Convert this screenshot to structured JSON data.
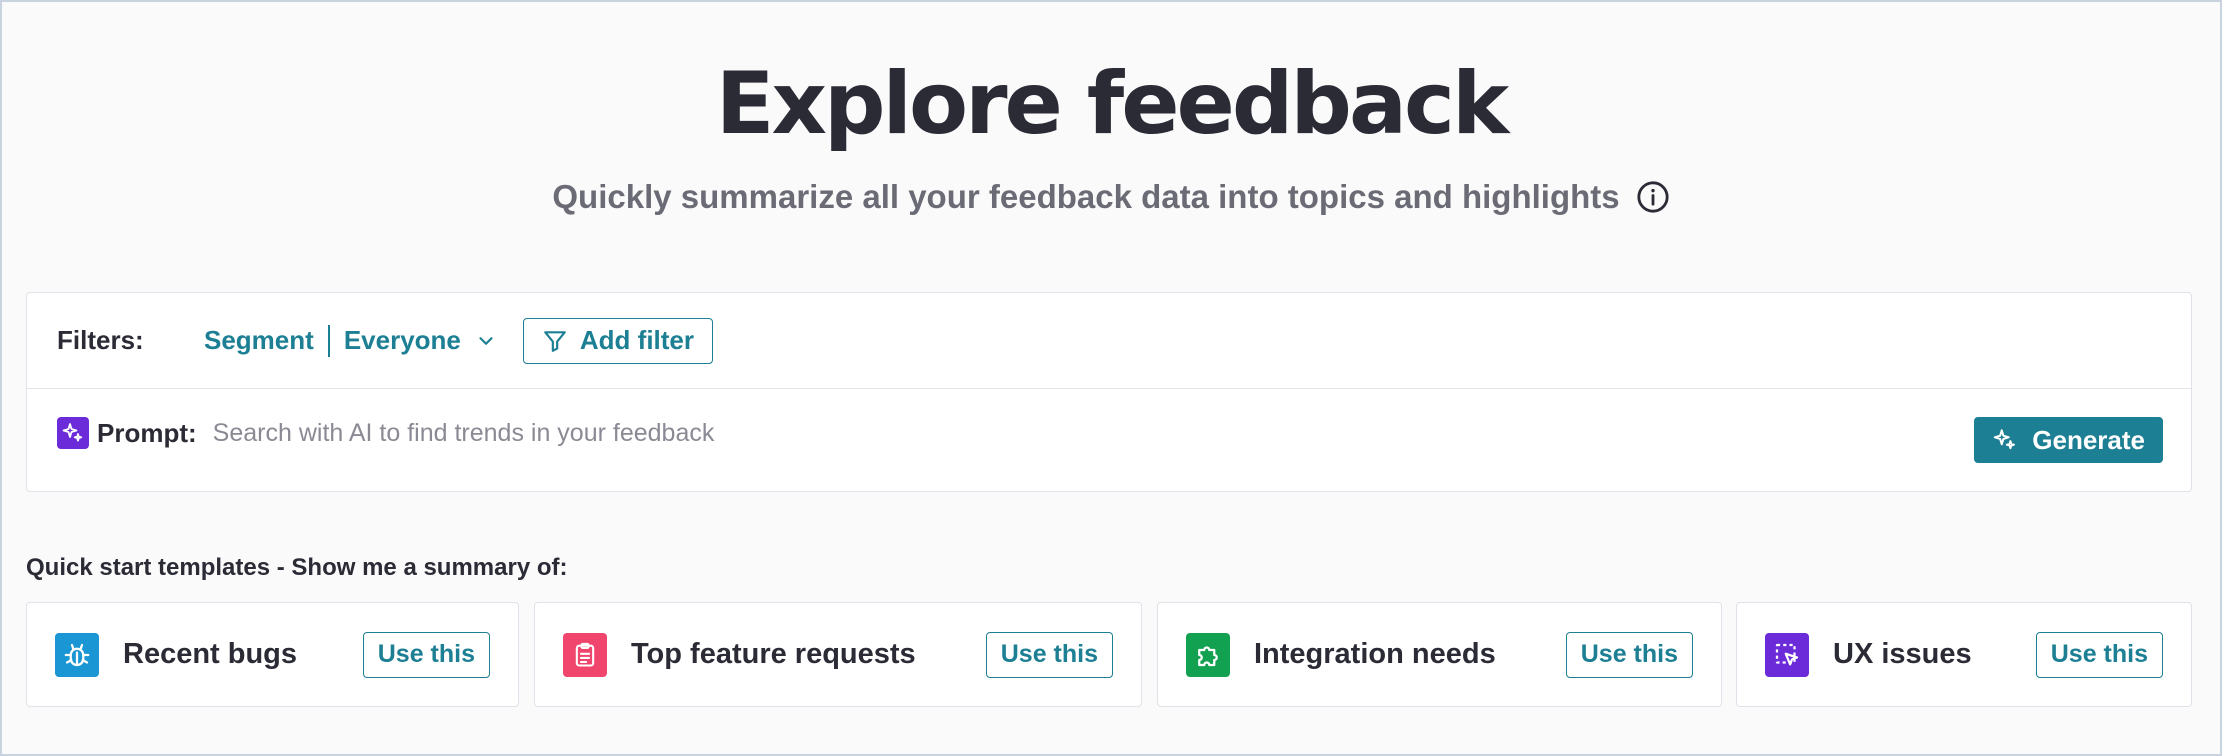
{
  "header": {
    "title": "Explore feedback",
    "subtitle": "Quickly summarize all your feedback data into topics and highlights",
    "info_icon": "info-circle-icon"
  },
  "filters": {
    "label": "Filters:",
    "segment_label": "Segment",
    "segment_value": "Everyone",
    "add_filter_label": "Add filter"
  },
  "prompt": {
    "label": "Prompt:",
    "placeholder": "Search with AI to find trends in your feedback",
    "value": "",
    "generate_label": "Generate",
    "icon": "sparkles-icon"
  },
  "templates": {
    "heading": "Quick start templates - Show me a summary of:",
    "items": [
      {
        "label": "Recent bugs",
        "button": "Use this",
        "icon": "bug-icon",
        "color": "#1a96d4"
      },
      {
        "label": "Top feature requests",
        "button": "Use this",
        "icon": "clipboard-icon",
        "color": "#f0456c"
      },
      {
        "label": "Integration needs",
        "button": "Use this",
        "icon": "puzzle-icon",
        "color": "#12a150"
      },
      {
        "label": "UX issues",
        "button": "Use this",
        "icon": "cursor-select-icon",
        "color": "#6c2bd9"
      }
    ]
  },
  "colors": {
    "accent": "#1d7f93",
    "text": "#2b2b36",
    "muted": "#6b6b76",
    "ai_purple": "#6c2bd9"
  }
}
